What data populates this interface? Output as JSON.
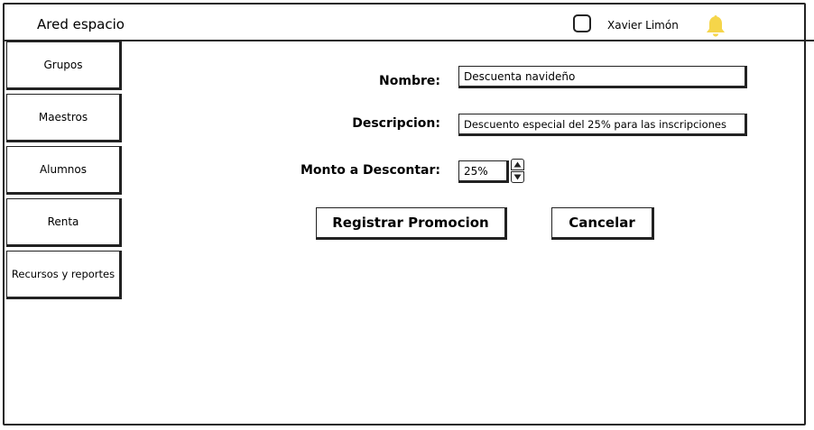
{
  "header": {
    "app_title": "Ared espacio",
    "user_name": "Xavier Limón",
    "bell_icon": "bell-icon",
    "bell_color": "#F5D54A"
  },
  "sidebar": {
    "items": [
      {
        "label": "Grupos"
      },
      {
        "label": "Maestros"
      },
      {
        "label": "Alumnos"
      },
      {
        "label": "Renta"
      },
      {
        "label": "Recursos y reportes"
      }
    ]
  },
  "form": {
    "nombre": {
      "label": "Nombre:",
      "value": "Descuenta navideño"
    },
    "descripcion": {
      "label": "Descripcion:",
      "value": "Descuento especial del 25% para las inscripciones"
    },
    "monto": {
      "label": "Monto a Descontar:",
      "value": "25%"
    },
    "buttons": {
      "register": "Registrar Promocion",
      "cancel": "Cancelar"
    }
  }
}
